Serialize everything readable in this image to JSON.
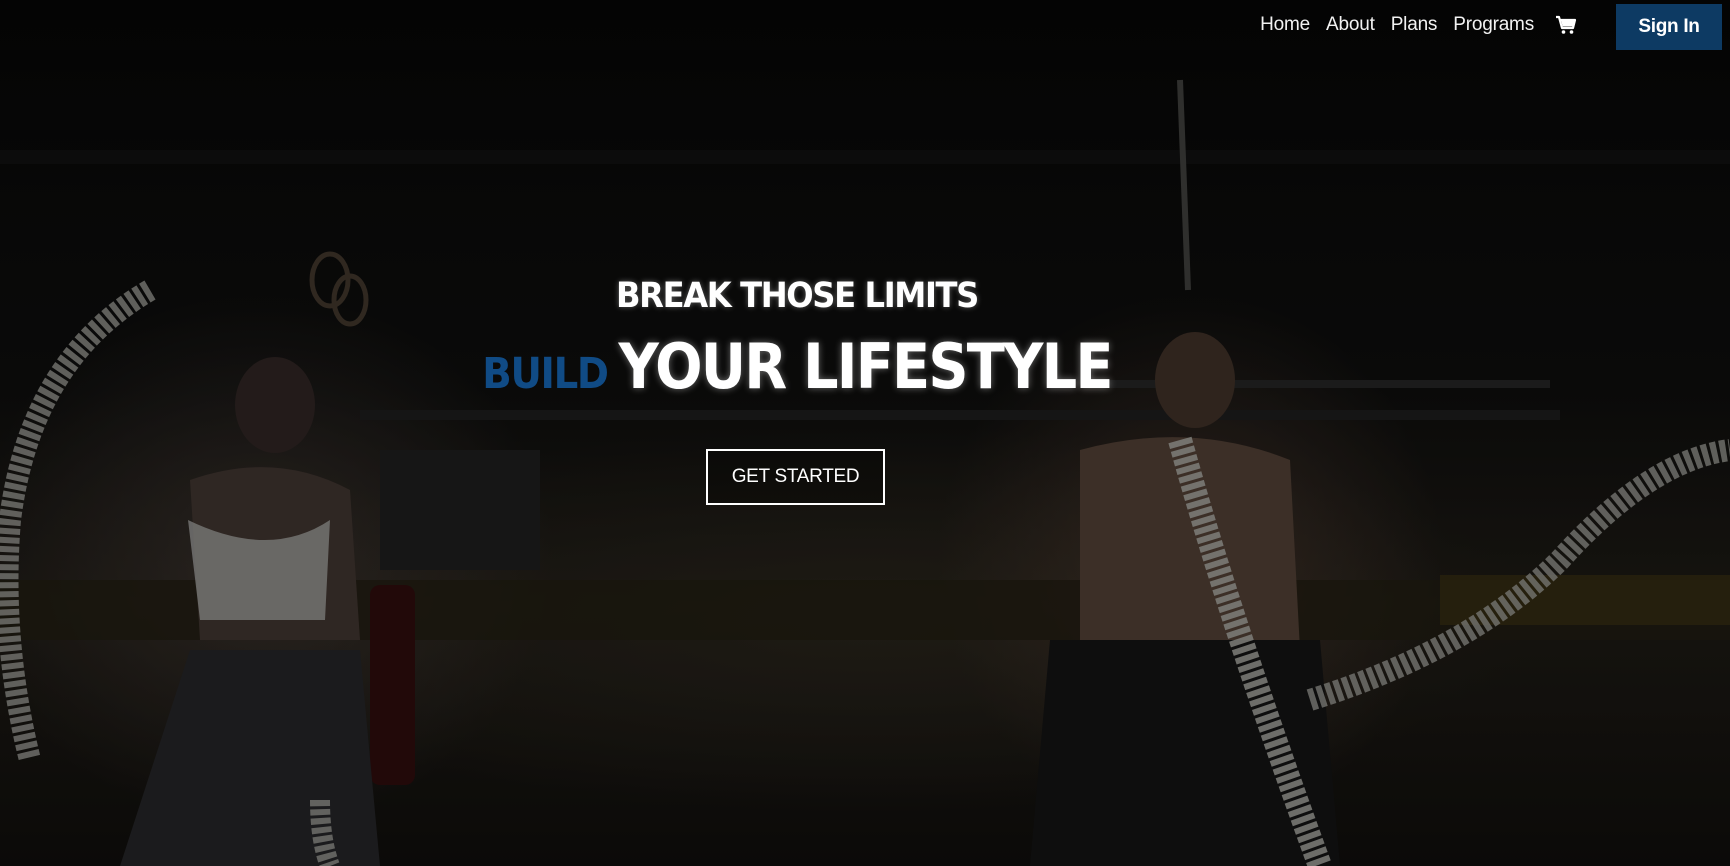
{
  "nav": {
    "links": [
      {
        "label": "Home"
      },
      {
        "label": "About"
      },
      {
        "label": "Plans"
      },
      {
        "label": "Programs"
      }
    ],
    "cart_icon": "shopping-cart-icon",
    "signin_label": "Sign In"
  },
  "hero": {
    "tagline": "BREAK THOSE LIMITS",
    "headline_accent": "BUILD",
    "headline_main": "YOUR LIFESTYLE",
    "cta_label": "GET STARTED"
  },
  "colors": {
    "accent": "#104b85",
    "signin_bg": "#0d3a63",
    "text": "#ffffff"
  }
}
